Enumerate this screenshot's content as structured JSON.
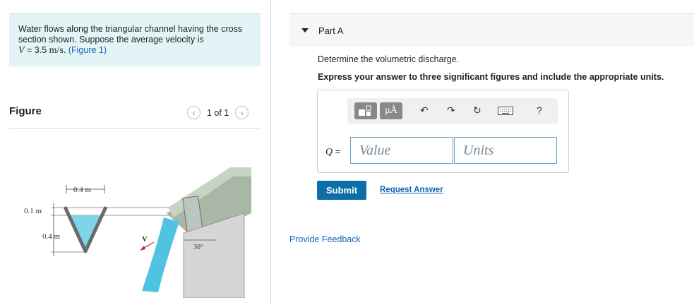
{
  "problem": {
    "text": "Water flows along the triangular channel having the cross section shown. Suppose the average velocity is",
    "velocity_symbol": "V",
    "velocity_eq": " = 3.5 ",
    "velocity_unit": "m/s",
    "velocity_end": ". ",
    "figure_link": "(Figure 1)"
  },
  "figure": {
    "heading": "Figure",
    "pager": "1 of 1",
    "labels": {
      "top_width": "0.4 m",
      "freeboard": "0.1 m",
      "depth": "0.4 m",
      "velocity": "V",
      "angle": "30°"
    }
  },
  "part": {
    "title": "Part A",
    "question": "Determine the volumetric discharge.",
    "instruction": "Express your answer to three significant figures and include the appropriate units."
  },
  "answer": {
    "variable": "Q",
    "equals": " =",
    "value_placeholder": "Value",
    "units_placeholder": "Units",
    "toolbar": {
      "units_button": "μÅ",
      "help": "?"
    }
  },
  "actions": {
    "submit": "Submit",
    "request_answer": "Request Answer",
    "feedback": "Provide Feedback"
  },
  "colors": {
    "accent": "#0e6ea8",
    "link": "#1565b6",
    "problem_bg": "#e3f4f6",
    "water": "#4fc3e0"
  }
}
